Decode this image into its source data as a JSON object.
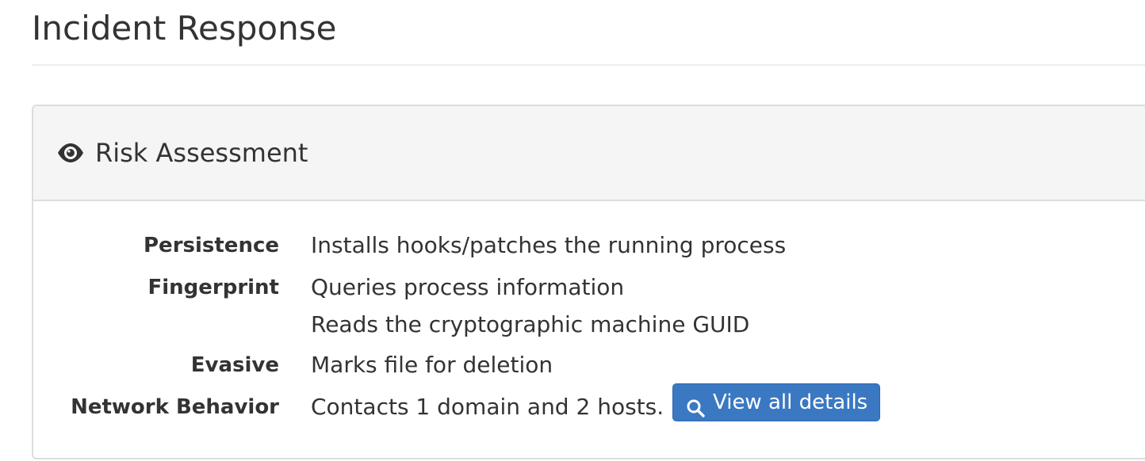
{
  "page": {
    "title": "Incident Response"
  },
  "panel": {
    "heading_icon": "eye-icon",
    "heading": "Risk Assessment"
  },
  "rows": [
    {
      "label": "Persistence",
      "value": "Installs hooks/patches the running process"
    },
    {
      "label": "Fingerprint",
      "value": "Queries process information"
    },
    {
      "label": "",
      "value": "Reads the cryptographic machine GUID"
    },
    {
      "label": "Evasive",
      "value": "Marks file for deletion"
    },
    {
      "label": "Network Behavior",
      "value": "Contacts 1 domain and 2 hosts."
    }
  ],
  "details_button": {
    "icon": "search-icon",
    "label": "View all details"
  },
  "colors": {
    "button": "#3a78c2",
    "panel_heading_bg": "#f5f5f5",
    "border": "#dddddd"
  }
}
